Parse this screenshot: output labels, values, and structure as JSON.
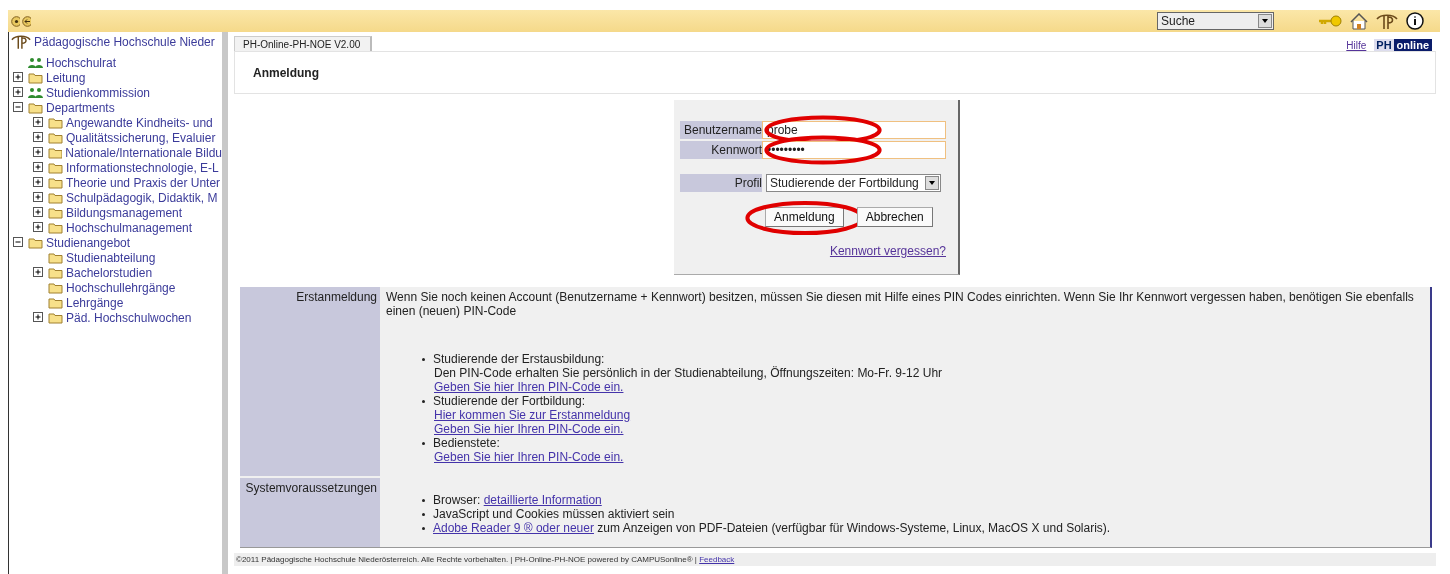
{
  "topbar": {
    "search": {
      "value": "Suche"
    }
  },
  "sidebar": {
    "title": "Pädagogische Hochschule Nieder",
    "items": [
      {
        "label": "Hochschulrat",
        "kind": "group"
      },
      {
        "label": "Leitung",
        "kind": "folder",
        "expanded": false
      },
      {
        "label": "Studienkommission",
        "kind": "group",
        "expanded": false
      },
      {
        "label": "Departments",
        "kind": "folder",
        "expanded": true,
        "children": [
          {
            "label": "Angewandte Kindheits- und",
            "kind": "folder",
            "expanded": false
          },
          {
            "label": "Qualitätssicherung, Evaluier",
            "kind": "folder",
            "expanded": false
          },
          {
            "label": "Nationale/Internationale Bildu",
            "kind": "folder",
            "expanded": false
          },
          {
            "label": "Informationstechnologie, E-L",
            "kind": "folder",
            "expanded": false
          },
          {
            "label": "Theorie und Praxis der Unter",
            "kind": "folder",
            "expanded": false
          },
          {
            "label": "Schulpädagogik, Didaktik, M",
            "kind": "folder",
            "expanded": false
          },
          {
            "label": "Bildungsmanagement",
            "kind": "folder",
            "expanded": false
          },
          {
            "label": "Hochschulmanagement",
            "kind": "folder",
            "expanded": false
          }
        ]
      },
      {
        "label": "Studienangebot",
        "kind": "folder",
        "expanded": true,
        "children": [
          {
            "label": "Studienabteilung",
            "kind": "folder"
          },
          {
            "label": "Bachelorstudien",
            "kind": "folder",
            "expanded": false
          },
          {
            "label": "Hochschullehrgänge",
            "kind": "folder"
          },
          {
            "label": "Lehrgänge",
            "kind": "folder"
          },
          {
            "label": "Päd. Hochschulwochen",
            "kind": "folder",
            "expanded": false
          }
        ]
      }
    ]
  },
  "tab": {
    "label": "PH-Online-PH-NOE V2.00",
    "selected": true
  },
  "help_link": "Hilfe",
  "logo": {
    "left": "PH",
    "right": "online"
  },
  "page_title": "Anmeldung",
  "login": {
    "fields": [
      {
        "label": "Benutzername",
        "value": "probe",
        "kind": "text",
        "circled": true
      },
      {
        "label": "Kennwort",
        "value": "•••••••••",
        "kind": "password",
        "circled": true
      },
      {
        "label": "Profil",
        "value": "Studierende der Fortbildung",
        "kind": "select",
        "circled": false
      }
    ],
    "buttons": [
      {
        "label": "Anmeldung",
        "circled": true
      },
      {
        "label": "Abbrechen",
        "circled": false
      }
    ],
    "forgot_link": "Kennwort vergessen?"
  },
  "info": [
    {
      "label": "Erstanmeldung",
      "intro": "Wenn Sie noch keinen Account (Benutzername + Kennwort) besitzen, müssen Sie diesen mit Hilfe eines PIN Codes einrichten. Wenn Sie Ihr Kennwort vergessen haben, benötigen Sie ebenfalls einen (neuen) PIN-Code",
      "bullets": [
        {
          "segments": [
            {
              "kind": "text",
              "text": "Studierende der Erstausbildung:"
            }
          ],
          "lines": [
            {
              "kind": "text",
              "text": "Den PIN-Code erhalten Sie persönlich in der Studienabteilung, Öffnungszeiten: Mo-Fr. 9-12 Uhr"
            },
            {
              "kind": "link",
              "text": "Geben Sie hier Ihren PIN-Code ein."
            }
          ]
        },
        {
          "segments": [
            {
              "kind": "text",
              "text": "Studierende der Fortbildung:"
            }
          ],
          "lines": [
            {
              "kind": "link",
              "text": "Hier kommen Sie zur Erstanmeldung"
            },
            {
              "kind": "link",
              "text": "Geben Sie hier Ihren PIN-Code ein."
            }
          ]
        },
        {
          "segments": [
            {
              "kind": "text",
              "text": "Bedienstete:"
            }
          ],
          "lines": [
            {
              "kind": "link",
              "text": "Geben Sie hier Ihren PIN-Code ein."
            }
          ]
        }
      ]
    },
    {
      "label": "Systemvoraussetzungen",
      "bullets": [
        {
          "segments": [
            {
              "kind": "text",
              "text": "Browser: "
            },
            {
              "kind": "link",
              "text": "detaillierte Information"
            }
          ]
        },
        {
          "segments": [
            {
              "kind": "text",
              "text": "JavaScript und Cookies müssen aktiviert sein"
            }
          ]
        },
        {
          "segments": [
            {
              "kind": "link",
              "text": "Adobe Reader 9 ® oder neuer"
            },
            {
              "kind": "text",
              "text": " zum Anzeigen von PDF-Dateien (verfügbar für Windows-Systeme, Linux, MacOS X und Solaris)."
            }
          ]
        }
      ]
    }
  ],
  "footer": {
    "text": "©2011 Pädagogische Hochschule Niederösterreich. Alle Rechte vorbehalten. | PH-Online-PH-NOE powered by CAMPUSonline® |",
    "link": "Feedback"
  }
}
